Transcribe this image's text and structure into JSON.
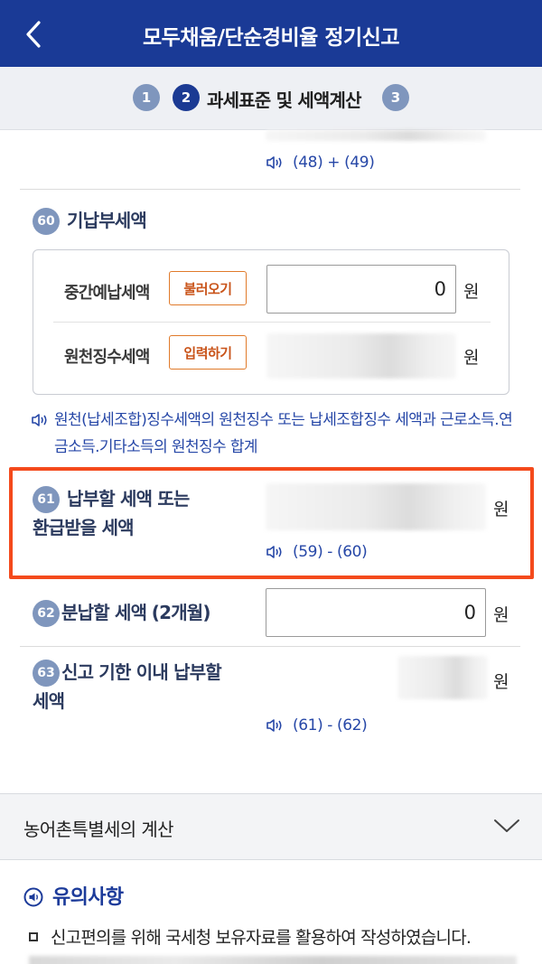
{
  "header": {
    "title": "모두채움/단순경비율 정기신고"
  },
  "stepper": {
    "steps": [
      {
        "num": "1",
        "state": "inactive"
      },
      {
        "num": "2",
        "state": "active",
        "label": "과세표준 및 세액계산"
      },
      {
        "num": "3",
        "state": "inactive"
      }
    ]
  },
  "top_hint": {
    "text": "(48) + (49)"
  },
  "sec60": {
    "num": "60",
    "title": "기납부세액",
    "rows": [
      {
        "label": "중간예납세액",
        "button": "불러오기",
        "value": "0",
        "unit": "원"
      },
      {
        "label": "원천징수세액",
        "button": "입력하기",
        "unit": "원"
      }
    ],
    "note": "원천(납세조합)징수세액의 원천징수 또는 납세조합징수 세액과 근로소득.연금소득.기타소득의 원천징수 합계"
  },
  "sec61": {
    "num": "61",
    "title_line1": "납부할 세액 또는",
    "title_line2": "환급받을 세액",
    "unit": "원",
    "hint": "(59) - (60)"
  },
  "sec62": {
    "num": "62",
    "title": "분납할 세액",
    "title_suffix": "(2개월)",
    "value": "0",
    "unit": "원"
  },
  "sec63": {
    "num": "63",
    "title_line1": "신고 기한 이내 납부할",
    "title_line2": "세액",
    "unit": "원",
    "hint": "(61) - (62)"
  },
  "accordion": {
    "label": "농어촌특별세의 계산",
    "icon": "chevron-down-icon"
  },
  "notice": {
    "title": "유의사항",
    "items": [
      "신고편의를 위해 국세청 보유자료를 활용하여 작성하였습니다."
    ]
  },
  "colors": {
    "header": "#1a3a96",
    "highlight": "#f44a1c",
    "link": "#2647a7",
    "badge": "#7f96bd",
    "button_text": "#c9541a"
  }
}
